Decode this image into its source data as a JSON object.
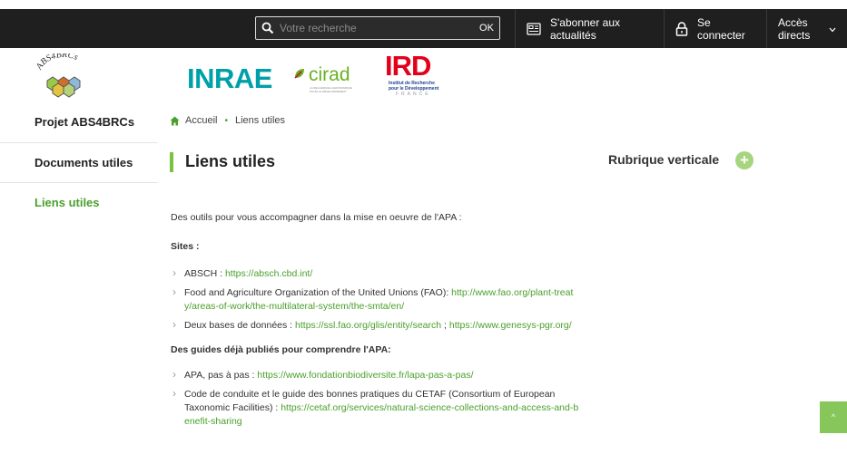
{
  "header": {
    "search_placeholder": "Votre recherche",
    "search_ok": "OK",
    "subscribe": "S'abonner aux actualités",
    "login": "Se connecter",
    "direct_access": "Accès directs"
  },
  "logos": {
    "abs": "ABS4BRCs",
    "inrae": "INRAE",
    "cirad": "cirad",
    "cirad_tagline": "LA RECHERCHE AGRONOMIQUE POUR LE DÉVELOPPEMENT",
    "ird": "IRD",
    "ird_line1": "Institut de Recherche",
    "ird_line2": "pour le Développement",
    "ird_line3": "FRANCE"
  },
  "sidebar": {
    "items": [
      {
        "label": "Projet ABS4BRCs"
      },
      {
        "label": "Documents utiles"
      },
      {
        "label": "Liens utiles"
      }
    ]
  },
  "breadcrumb": {
    "home": "Accueil",
    "current": "Liens utiles"
  },
  "page": {
    "title": "Liens utiles",
    "aside_title": "Rubrique verticale",
    "intro": "Des outils pour vous accompagner dans la mise en oeuvre de l'APA :",
    "sites_heading": "Sites :",
    "sites": [
      {
        "text": "ABSCH : ",
        "link": "https://absch.cbd.int/"
      },
      {
        "text": "Food and Agriculture Organization of the United Unions (FAO): ",
        "link": "http://www.fao.org/plant-treaty/areas-of-work/the-multilateral-system/the-smta/en/"
      },
      {
        "text": "Deux bases de données : ",
        "link": "https://ssl.fao.org/glis/entity/search",
        "sep": " ; ",
        "link2": "https://www.genesys-pgr.org/"
      }
    ],
    "guides_heading": "Des guides déjà publiés pour comprendre l'APA:",
    "guides": [
      {
        "text": "APA, pas à pas : ",
        "link": "https://www.fondationbiodiversite.fr/lapa-pas-a-pas/"
      },
      {
        "text": "Code de conduite et le guide des bonnes pratiques du CETAF (Consortium of European Taxonomic Facilities) : ",
        "link": "https://cetaf.org/services/natural-science-collections-and-access-and-benefit-sharing"
      }
    ]
  },
  "colors": {
    "topbar": "#1f1f1f",
    "accent_green": "#4aa02c",
    "inrae_teal": "#00a0a8",
    "ird_red": "#e3001b",
    "ird_blue": "#1d3f8f"
  }
}
